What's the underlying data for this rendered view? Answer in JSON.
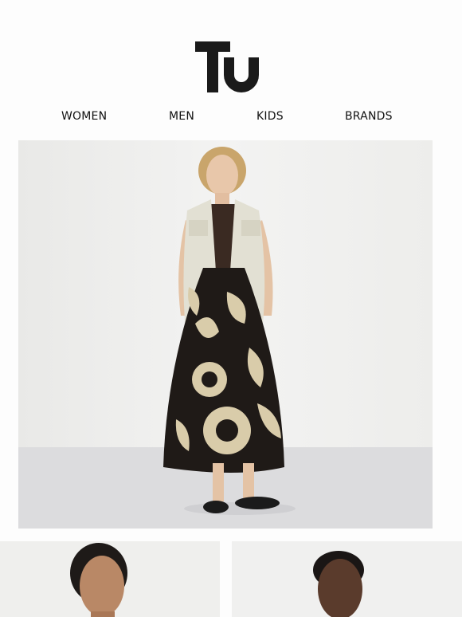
{
  "brand": {
    "name": "Tu",
    "logo_text": "Tu"
  },
  "nav": {
    "items": [
      {
        "label": "WOMEN"
      },
      {
        "label": "MEN"
      },
      {
        "label": "KIDS"
      },
      {
        "label": "BRANDS"
      }
    ]
  },
  "colors": {
    "background": "#fdfdfd",
    "text": "#111111",
    "logo": "#1a1a1a",
    "vest": "#e2e0d3",
    "skirt_dark": "#1f1a17",
    "skirt_print": "#d9ccaa"
  },
  "images": {
    "hero": "model-in-cream-vest-and-printed-skirt",
    "tile_left": "model-portrait-left",
    "tile_right": "model-portrait-right"
  }
}
